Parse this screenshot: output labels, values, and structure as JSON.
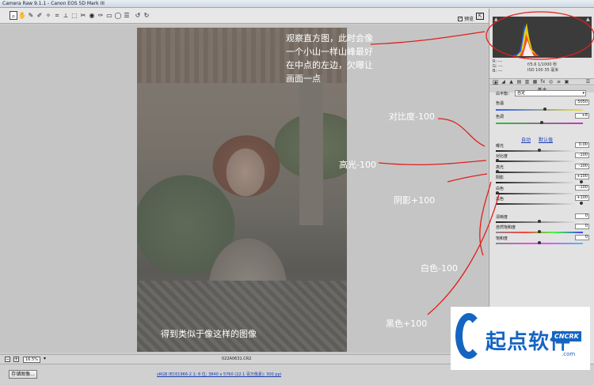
{
  "window": {
    "title": "Camera Raw 9.1.1 -  Canon EOS 5D Mark III"
  },
  "toolbar": {
    "tools": [
      {
        "name": "zoom-tool-icon",
        "glyph": "⌕"
      },
      {
        "name": "hand-tool-icon",
        "glyph": "✋"
      },
      {
        "name": "white-balance-tool-icon",
        "glyph": "✎"
      },
      {
        "name": "color-sampler-tool-icon",
        "glyph": "✐"
      },
      {
        "name": "targeted-adjustment-tool-icon",
        "glyph": "✧"
      },
      {
        "name": "crop-tool-icon",
        "glyph": "⌗"
      },
      {
        "name": "straighten-tool-icon",
        "glyph": "⟂"
      },
      {
        "name": "transform-tool-icon",
        "glyph": "⬚"
      },
      {
        "name": "spot-removal-tool-icon",
        "glyph": "✂"
      },
      {
        "name": "red-eye-tool-icon",
        "glyph": "◉"
      },
      {
        "name": "adjustment-brush-icon",
        "glyph": "✑"
      },
      {
        "name": "graduated-filter-icon",
        "glyph": "▭"
      },
      {
        "name": "radial-filter-icon",
        "glyph": "◯"
      },
      {
        "name": "preferences-icon",
        "glyph": "☰"
      },
      {
        "name": "rotate-left-icon",
        "glyph": "↺"
      },
      {
        "name": "rotate-right-icon",
        "glyph": "↻"
      }
    ],
    "preview_label": "预览",
    "preview_checked": "✓"
  },
  "photo": {
    "note": "观察直方图，此时会像\n一个小山一样山峰最好\n在中点的左边，欠曝让\n画面一点",
    "caption": "得到类似于像这样的图像"
  },
  "annotations": {
    "contrast": "对比度-100",
    "highlights": "高光-100",
    "shadows": "阴影+100",
    "whites": "白色-100",
    "blacks": "黑色+100"
  },
  "info": {
    "r": "R:  ---",
    "g": "G:  ---",
    "b": "B:  ---",
    "exposure": "f/5.6   1/1000 秒",
    "iso": "ISO 100   35 毫米"
  },
  "panel": {
    "section_title": "基本",
    "white_balance_label": "白平衡：",
    "white_balance_value": "自定",
    "temperature_label": "色温",
    "temperature_value": "5050",
    "tint_label": "色调",
    "tint_value": "+6",
    "auto_label": "自动",
    "default_label": "默认值",
    "rows": [
      {
        "label": "曝光",
        "value": "0.00",
        "level": 0.5
      },
      {
        "label": "对比度",
        "value": "-100",
        "level": 0.0
      },
      {
        "label": "高光",
        "value": "-100",
        "level": 0.0
      },
      {
        "label": "阴影",
        "value": "+100",
        "level": 1.0
      },
      {
        "label": "白色",
        "value": "-100",
        "level": 0.0
      },
      {
        "label": "黑色",
        "value": "+100",
        "level": 1.0
      },
      {
        "label": "清晰度",
        "value": "0",
        "level": 0.5
      },
      {
        "label": "自然饱和度",
        "value": "0",
        "level": 0.5
      },
      {
        "label": "饱和度",
        "value": "0",
        "level": 0.5
      }
    ]
  },
  "bottom": {
    "zoom_value": "16.5%",
    "filename": "022A0631.CR2",
    "save_button": "存储图像...",
    "workflow": "sRGB IEC61966-2.1; 8 位; 3840 x 5760 (22.1 百万像素); 300 ppi"
  },
  "logo": {
    "text": "起点软件",
    "badge": "CNCRK",
    "dotcom": ".com"
  },
  "colors": {
    "annotation_red": "#e0201c",
    "link_blue": "#1a3cb0",
    "brand_blue": "#1565c0"
  }
}
